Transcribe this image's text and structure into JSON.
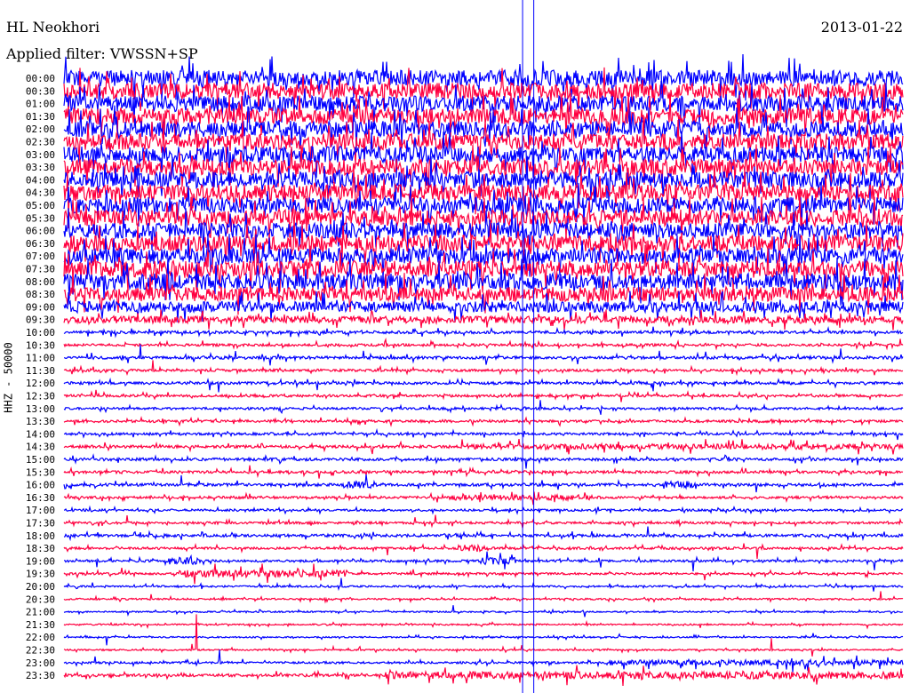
{
  "header": {
    "station": "HL Neokhori",
    "filter": "Applied filter: VWSSN+SP",
    "date": "2013-01-22",
    "channel": "HHZ - 50000"
  },
  "chart_data": {
    "type": "line",
    "title": "HL Neokhori 2013-01-22",
    "subtitle": "Applied filter: VWSSN+SP",
    "ylabel": "HHZ - 50000",
    "xlabel": "",
    "x_range_minutes": [
      0,
      30
    ],
    "colors": [
      "#0000ff",
      "#ff0040"
    ],
    "row_labels": [
      "00:00",
      "00:30",
      "01:00",
      "01:30",
      "02:00",
      "02:30",
      "03:00",
      "03:30",
      "04:00",
      "04:30",
      "05:00",
      "05:30",
      "06:00",
      "06:30",
      "07:00",
      "07:30",
      "08:00",
      "08:30",
      "09:00",
      "09:30",
      "10:00",
      "10:30",
      "11:00",
      "11:30",
      "12:00",
      "12:30",
      "13:00",
      "13:30",
      "14:00",
      "14:30",
      "15:00",
      "15:30",
      "16:00",
      "16:30",
      "17:00",
      "17:30",
      "18:00",
      "18:30",
      "19:00",
      "19:30",
      "20:00",
      "20:30",
      "21:00",
      "21:30",
      "22:00",
      "22:30",
      "23:00",
      "23:30"
    ],
    "relative_noise_level": [
      9,
      9,
      9,
      9,
      9,
      9,
      9,
      9,
      9,
      9,
      9,
      9,
      9,
      9,
      9,
      9,
      9,
      8,
      6,
      4,
      1.6,
      1.4,
      1.6,
      1.4,
      1.5,
      1.4,
      1.3,
      1.4,
      1.4,
      1.6,
      1.6,
      1.5,
      1.6,
      1.4,
      1.3,
      1.3,
      1.6,
      1.3,
      1.3,
      1.2,
      1.0,
      1.0,
      0.8,
      0.8,
      0.8,
      0.9,
      1.2,
      1.6
    ],
    "events": [
      {
        "row": "14:30",
        "start_min": 14.2,
        "end_min": 30,
        "level": 3
      },
      {
        "row": "16:00",
        "start_min": 10.0,
        "end_min": 11.2,
        "level": 4
      },
      {
        "row": "16:00",
        "start_min": 21.5,
        "end_min": 22.5,
        "level": 4
      },
      {
        "row": "16:30",
        "start_min": 13.7,
        "end_min": 18.9,
        "level": 3
      },
      {
        "row": "18:30",
        "start_min": 14.1,
        "end_min": 15.2,
        "level": 4
      },
      {
        "row": "19:00",
        "start_min": 3.7,
        "end_min": 5.0,
        "level": 4
      },
      {
        "row": "19:00",
        "start_min": 14.9,
        "end_min": 16.2,
        "level": 4
      },
      {
        "row": "19:30",
        "start_min": 4.3,
        "end_min": 10.2,
        "level": 4
      },
      {
        "row": "23:00",
        "start_min": 19.4,
        "end_min": 30,
        "level": 3
      },
      {
        "row": "23:30",
        "start_min": 11.5,
        "end_min": 30,
        "level": 4
      }
    ],
    "vertical_markers_min": [
      16.4,
      16.8
    ]
  }
}
